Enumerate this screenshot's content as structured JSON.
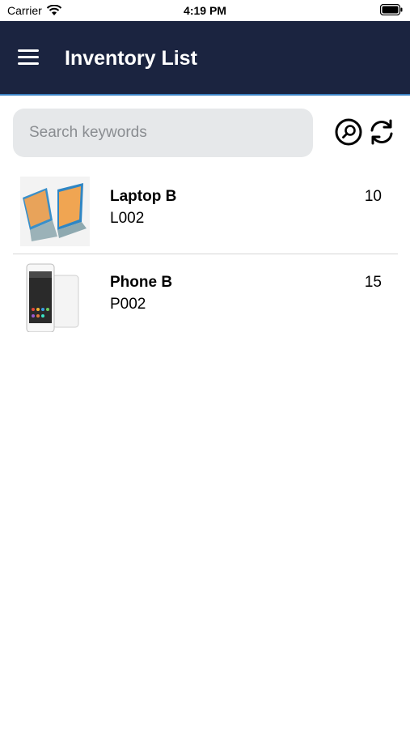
{
  "status_bar": {
    "carrier": "Carrier",
    "time": "4:19 PM"
  },
  "header": {
    "title": "Inventory List",
    "menu_icon": "hamburger-menu-icon",
    "background": "#1b2440",
    "accent_line": "#3b82c4"
  },
  "search": {
    "placeholder": "Search keywords",
    "value": "",
    "search_icon": "search-icon",
    "refresh_icon": "refresh-icon"
  },
  "items": [
    {
      "name": "Laptop B",
      "code": "L002",
      "quantity": "10",
      "image": "laptop-image"
    },
    {
      "name": "Phone B",
      "code": "P002",
      "quantity": "15",
      "image": "phone-image"
    }
  ]
}
